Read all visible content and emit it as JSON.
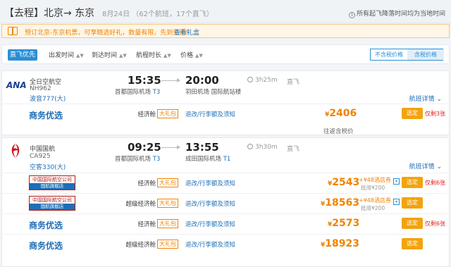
{
  "header": {
    "trip_label": "【去程】",
    "route": "北京→ 东京",
    "date_info": "8月24日 （62个航班，17个直飞）",
    "note": "所有起飞降落时间均为当地时间"
  },
  "promo": {
    "text": "预订北京-东京机票，可享精选好礼，数量有限，先到先得！",
    "link": "查看礼盒"
  },
  "sort": {
    "items": [
      "直飞优先",
      "出发时间",
      "到达时间",
      "航程时长",
      "价格"
    ],
    "price_toggle": [
      "不含税价格",
      "含税价格"
    ]
  },
  "flights": [
    {
      "airline": "全日空航空",
      "flight_no": "NH962",
      "aircraft": "波音777(大)",
      "dep_time": "15:35",
      "dep_airport": "首都国际机场",
      "dep_terminal": "T3",
      "arr_time": "20:00",
      "arr_airport": "羽田机场 国际航站楼",
      "arr_terminal": "",
      "duration": "3h25m",
      "stop": "直飞",
      "detail_link": "航班详情",
      "fares": [
        {
          "brand": "商务优选",
          "cabin": "经济舱",
          "gift": "大礼包",
          "rules": "退改/行李额及须知",
          "price": "2406",
          "book": "选定",
          "left": "仅剩3张"
        }
      ],
      "tax_note": "往返含税价"
    },
    {
      "airline": "中国国航",
      "flight_no": "CA925",
      "aircraft": "空客330(大)",
      "dep_time": "09:25",
      "dep_airport": "首都国际机场",
      "dep_terminal": "T3",
      "arr_time": "13:55",
      "arr_airport": "成田国际机场",
      "arr_terminal": "T1",
      "duration": "3h30m",
      "stop": "直飞",
      "detail_link": "航班详情",
      "fares": [
        {
          "brand_top": "中国国际航空公司",
          "brand_bot": "国航旗舰店",
          "cabin": "经济舱",
          "gift": "大礼包",
          "rules": "退改/行李额及须知",
          "price": "2543",
          "hotel": "+¥48酒店券",
          "hotel_sub": "抵用¥200",
          "book": "选定",
          "left": "仅剩6张"
        },
        {
          "brand_top": "中国国际航空公司",
          "brand_bot": "国航旗舰店",
          "cabin": "超级经济舱",
          "gift": "大礼包",
          "rules": "退改/行李额及须知",
          "price": "18563",
          "hotel": "+¥48酒店券",
          "hotel_sub": "抵用¥200",
          "book": "选定",
          "left": ""
        },
        {
          "brand": "商务优选",
          "cabin": "经济舱",
          "gift": "大礼包",
          "rules": "退改/行李额及须知",
          "price": "2573",
          "book": "选定",
          "left": "仅剩6张"
        },
        {
          "brand": "商务优选",
          "cabin": "超级经济舱",
          "gift": "大礼包",
          "rules": "退改/行李额及须知",
          "price": "18923",
          "book": "选定",
          "left": ""
        }
      ]
    }
  ],
  "currency": "¥",
  "colors": {
    "accent": "#2a8fd6",
    "price": "#f08300",
    "brand": "#1f6eb5",
    "warn": "#e02020"
  }
}
